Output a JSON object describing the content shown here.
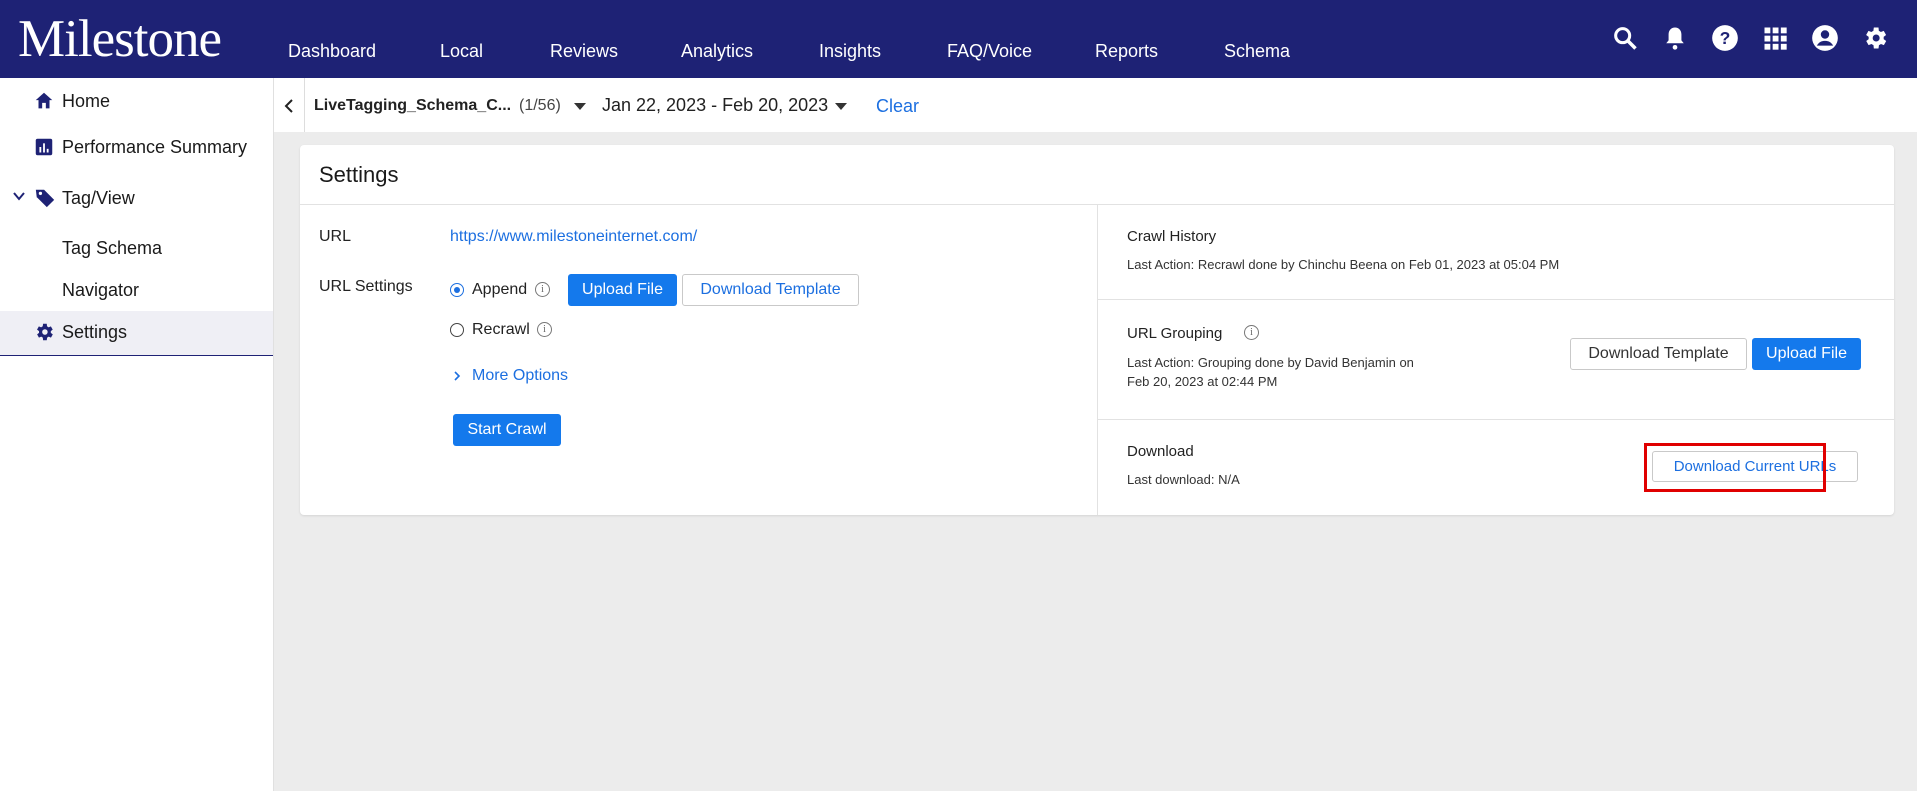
{
  "app": {
    "logo": "Milestone",
    "nav": [
      "Dashboard",
      "Local",
      "Reviews",
      "Analytics",
      "Insights",
      "FAQ/Voice",
      "Reports",
      "Schema"
    ],
    "icons": [
      "search-icon",
      "bell-icon",
      "help-icon",
      "apps-grid-icon",
      "account-icon",
      "gear-icon"
    ]
  },
  "sidebar": {
    "home": "Home",
    "performance": "Performance Summary",
    "tag_view": "Tag/View",
    "tag_schema": "Tag Schema",
    "navigator": "Navigator",
    "settings": "Settings"
  },
  "filter": {
    "tag": "LiveTagging_Schema_C...",
    "count": "(1/56)",
    "date_range": "Jan 22, 2023 - Feb 20, 2023",
    "clear": "Clear"
  },
  "settings": {
    "title": "Settings",
    "url_label": "URL",
    "url_value": "https://www.milestoneinternet.com/",
    "url_settings_label": "URL Settings",
    "append": "Append",
    "recrawl": "Recrawl",
    "upload_file": "Upload File",
    "download_template": "Download Template",
    "more_options": "More Options",
    "start_crawl": "Start Crawl"
  },
  "crawl_history": {
    "title": "Crawl History",
    "last_action": "Last Action: Recrawl done by Chinchu Beena on Feb 01, 2023 at 05:04 PM"
  },
  "url_grouping": {
    "title": "URL Grouping",
    "last_action_1": "Last Action: Grouping done by David Benjamin on",
    "last_action_2": "Feb 20, 2023 at 02:44 PM",
    "download_template": "Download Template",
    "upload_file": "Upload File"
  },
  "download": {
    "title": "Download",
    "last_download": "Last download: N/A",
    "button": "Download Current URLs"
  },
  "colors": {
    "brand": "#1e2275",
    "primary": "#1479ec",
    "link": "#1c6fe0",
    "highlight": "#e00000"
  }
}
